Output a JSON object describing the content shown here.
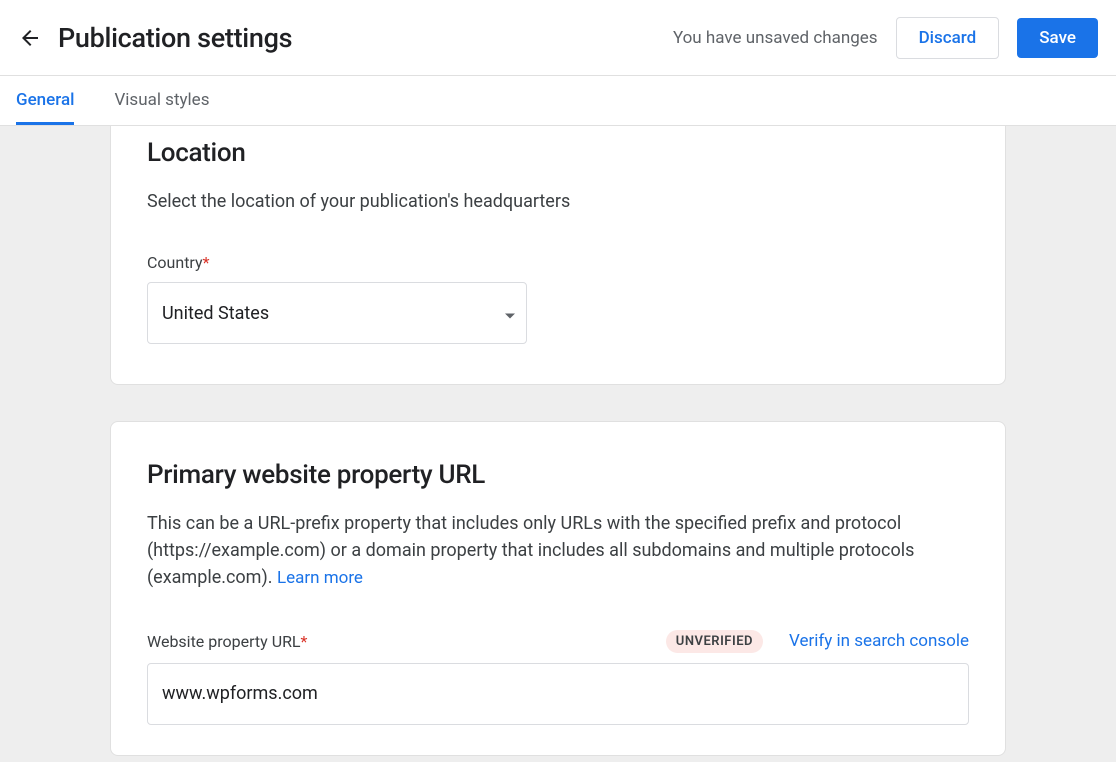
{
  "header": {
    "title": "Publication settings",
    "unsaved_message": "You have unsaved changes",
    "discard_label": "Discard",
    "save_label": "Save"
  },
  "tabs": {
    "general": "General",
    "visual_styles": "Visual styles"
  },
  "location_section": {
    "title": "Location",
    "description": "Select the location of your publication's headquarters",
    "country_label": "Country",
    "country_value": "United States"
  },
  "url_section": {
    "title": "Primary website property URL",
    "description": "This can be a URL-prefix property that includes only URLs with the specified prefix and protocol (https://example.com) or a domain property that includes all subdomains and multiple protocols (example.com). ",
    "learn_more": "Learn more",
    "field_label": "Website property URL",
    "badge": "UNVERIFIED",
    "verify_link": "Verify in search console",
    "value": "www.wpforms.com"
  }
}
